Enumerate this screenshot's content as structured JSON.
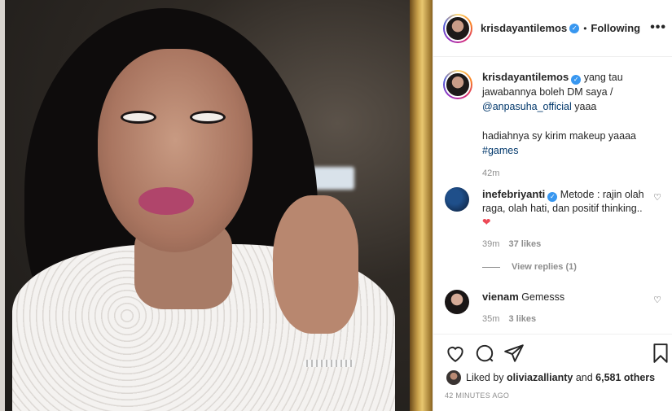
{
  "post": {
    "author": "krisdayantilemos",
    "follow_status": "Following",
    "separator": "•",
    "more_glyph": "•••"
  },
  "caption": {
    "username": "krisdayantilemos",
    "line1": "yang tau jawabannya boleh DM saya /",
    "mention": "@anpasuha_official",
    "line1_end": " yaaa",
    "line2": "hadiahnya sy kirim makeup yaaaa",
    "hashtag": "#games",
    "time": "42m"
  },
  "comments": [
    {
      "username": "inefebriyanti",
      "text": "Metode : rajin olah raga, olah hati, dan positif thinking..",
      "emoji": "❤",
      "time": "39m",
      "likes": "37 likes",
      "view_replies": "View replies (1)"
    },
    {
      "username": "vienam",
      "text": "Gemesss",
      "time": "35m",
      "likes": "3 likes"
    }
  ],
  "footer": {
    "liked_by_prefix": "Liked by",
    "liked_by_user": "oliviazallianty",
    "and": "and",
    "others": "6,581 others",
    "posted_ago": "42 MINUTES AGO"
  },
  "icons": [
    "like-heart-icon",
    "comment-bubble-icon",
    "share-paper-plane-icon",
    "bookmark-icon",
    "more-options-icon",
    "verified-badge-icon",
    "comment-like-icon"
  ]
}
